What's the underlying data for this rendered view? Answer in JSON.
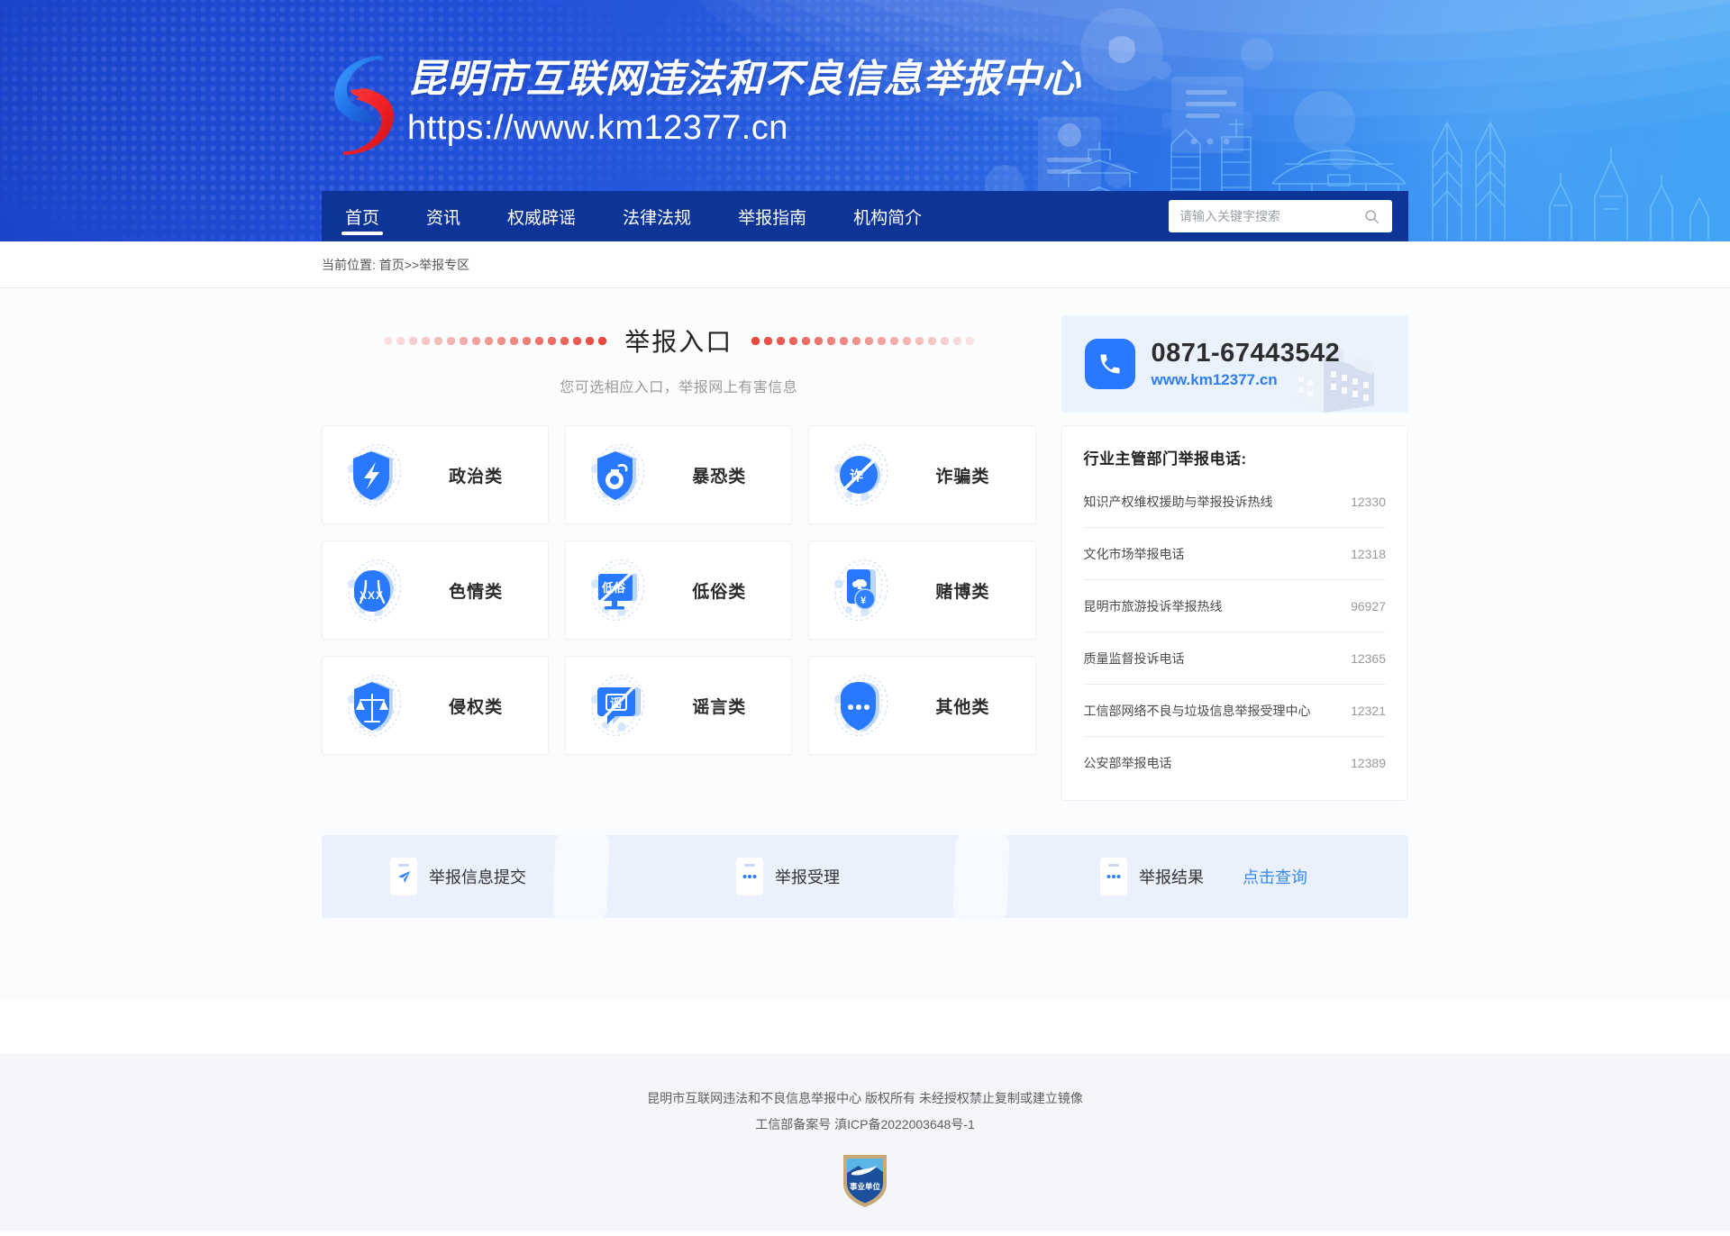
{
  "header": {
    "logo_icon": "s-swoosh-logo",
    "title": "昆明市互联网违法和不良信息举报中心",
    "url": "https://www.km12377.cn"
  },
  "nav": {
    "items": [
      {
        "label": "首页",
        "active": true
      },
      {
        "label": "资讯",
        "active": false
      },
      {
        "label": "权威辟谣",
        "active": false
      },
      {
        "label": "法律法规",
        "active": false
      },
      {
        "label": "举报指南",
        "active": false
      },
      {
        "label": "机构简介",
        "active": false
      }
    ],
    "search": {
      "placeholder": "请输入关键字搜索",
      "value": "",
      "icon": "search-icon"
    }
  },
  "breadcrumb": {
    "text": "当前位置: 首页>>举报专区"
  },
  "main": {
    "section_title": "举报入口",
    "section_subtitle": "您可选相应入口，举报网上有害信息",
    "categories": [
      {
        "label": "政治类",
        "icon": "shield-politics-icon"
      },
      {
        "label": "暴恐类",
        "icon": "shield-grenade-icon"
      },
      {
        "label": "诈骗类",
        "icon": "fraud-blocked-icon"
      },
      {
        "label": "色情类",
        "icon": "porn-xxx-icon"
      },
      {
        "label": "低俗类",
        "icon": "vulgar-blocked-icon"
      },
      {
        "label": "赌博类",
        "icon": "gambling-card-icon"
      },
      {
        "label": "侵权类",
        "icon": "shield-scales-icon"
      },
      {
        "label": "谣言类",
        "icon": "rumor-blocked-icon"
      },
      {
        "label": "其他类",
        "icon": "shield-dots-icon"
      }
    ]
  },
  "sidebar": {
    "phone": {
      "icon": "phone-icon",
      "number": "0871-67443542",
      "site": "www.km12377.cn"
    },
    "hotline_title": "行业主管部门举报电话:",
    "hotlines": [
      {
        "name": "知识产权维权援助与举报投诉热线",
        "number": "12330"
      },
      {
        "name": "文化市场举报电话",
        "number": "12318"
      },
      {
        "name": "昆明市旅游投诉举报热线",
        "number": "96927"
      },
      {
        "name": "质量监督投诉电话",
        "number": "12365"
      },
      {
        "name": "工信部网络不良与垃圾信息举报受理中心",
        "number": "12321"
      },
      {
        "name": "公安部举报电话",
        "number": "12389"
      }
    ]
  },
  "process": {
    "steps": [
      {
        "label": "举报信息提交",
        "icon": "paper-plane-icon"
      },
      {
        "label": "举报受理",
        "icon": "dots-icon"
      },
      {
        "label": "举报结果",
        "icon": "dots-icon"
      }
    ],
    "query_link": "点击查询"
  },
  "footer": {
    "copyright": "昆明市互联网违法和不良信息举报中心 版权所有 未经授权禁止复制或建立镜像",
    "icp": "工信部备案号 滇ICP备2022003648号-1",
    "badge_text": "事业单位",
    "badge_icon": "gov-shield-icon"
  },
  "colors": {
    "brand_blue": "#2150d8",
    "nav_blue": "#0d3496",
    "accent_blue": "#2979ff",
    "dot_red": "#e8453c",
    "link_blue": "#3a8bf0"
  }
}
